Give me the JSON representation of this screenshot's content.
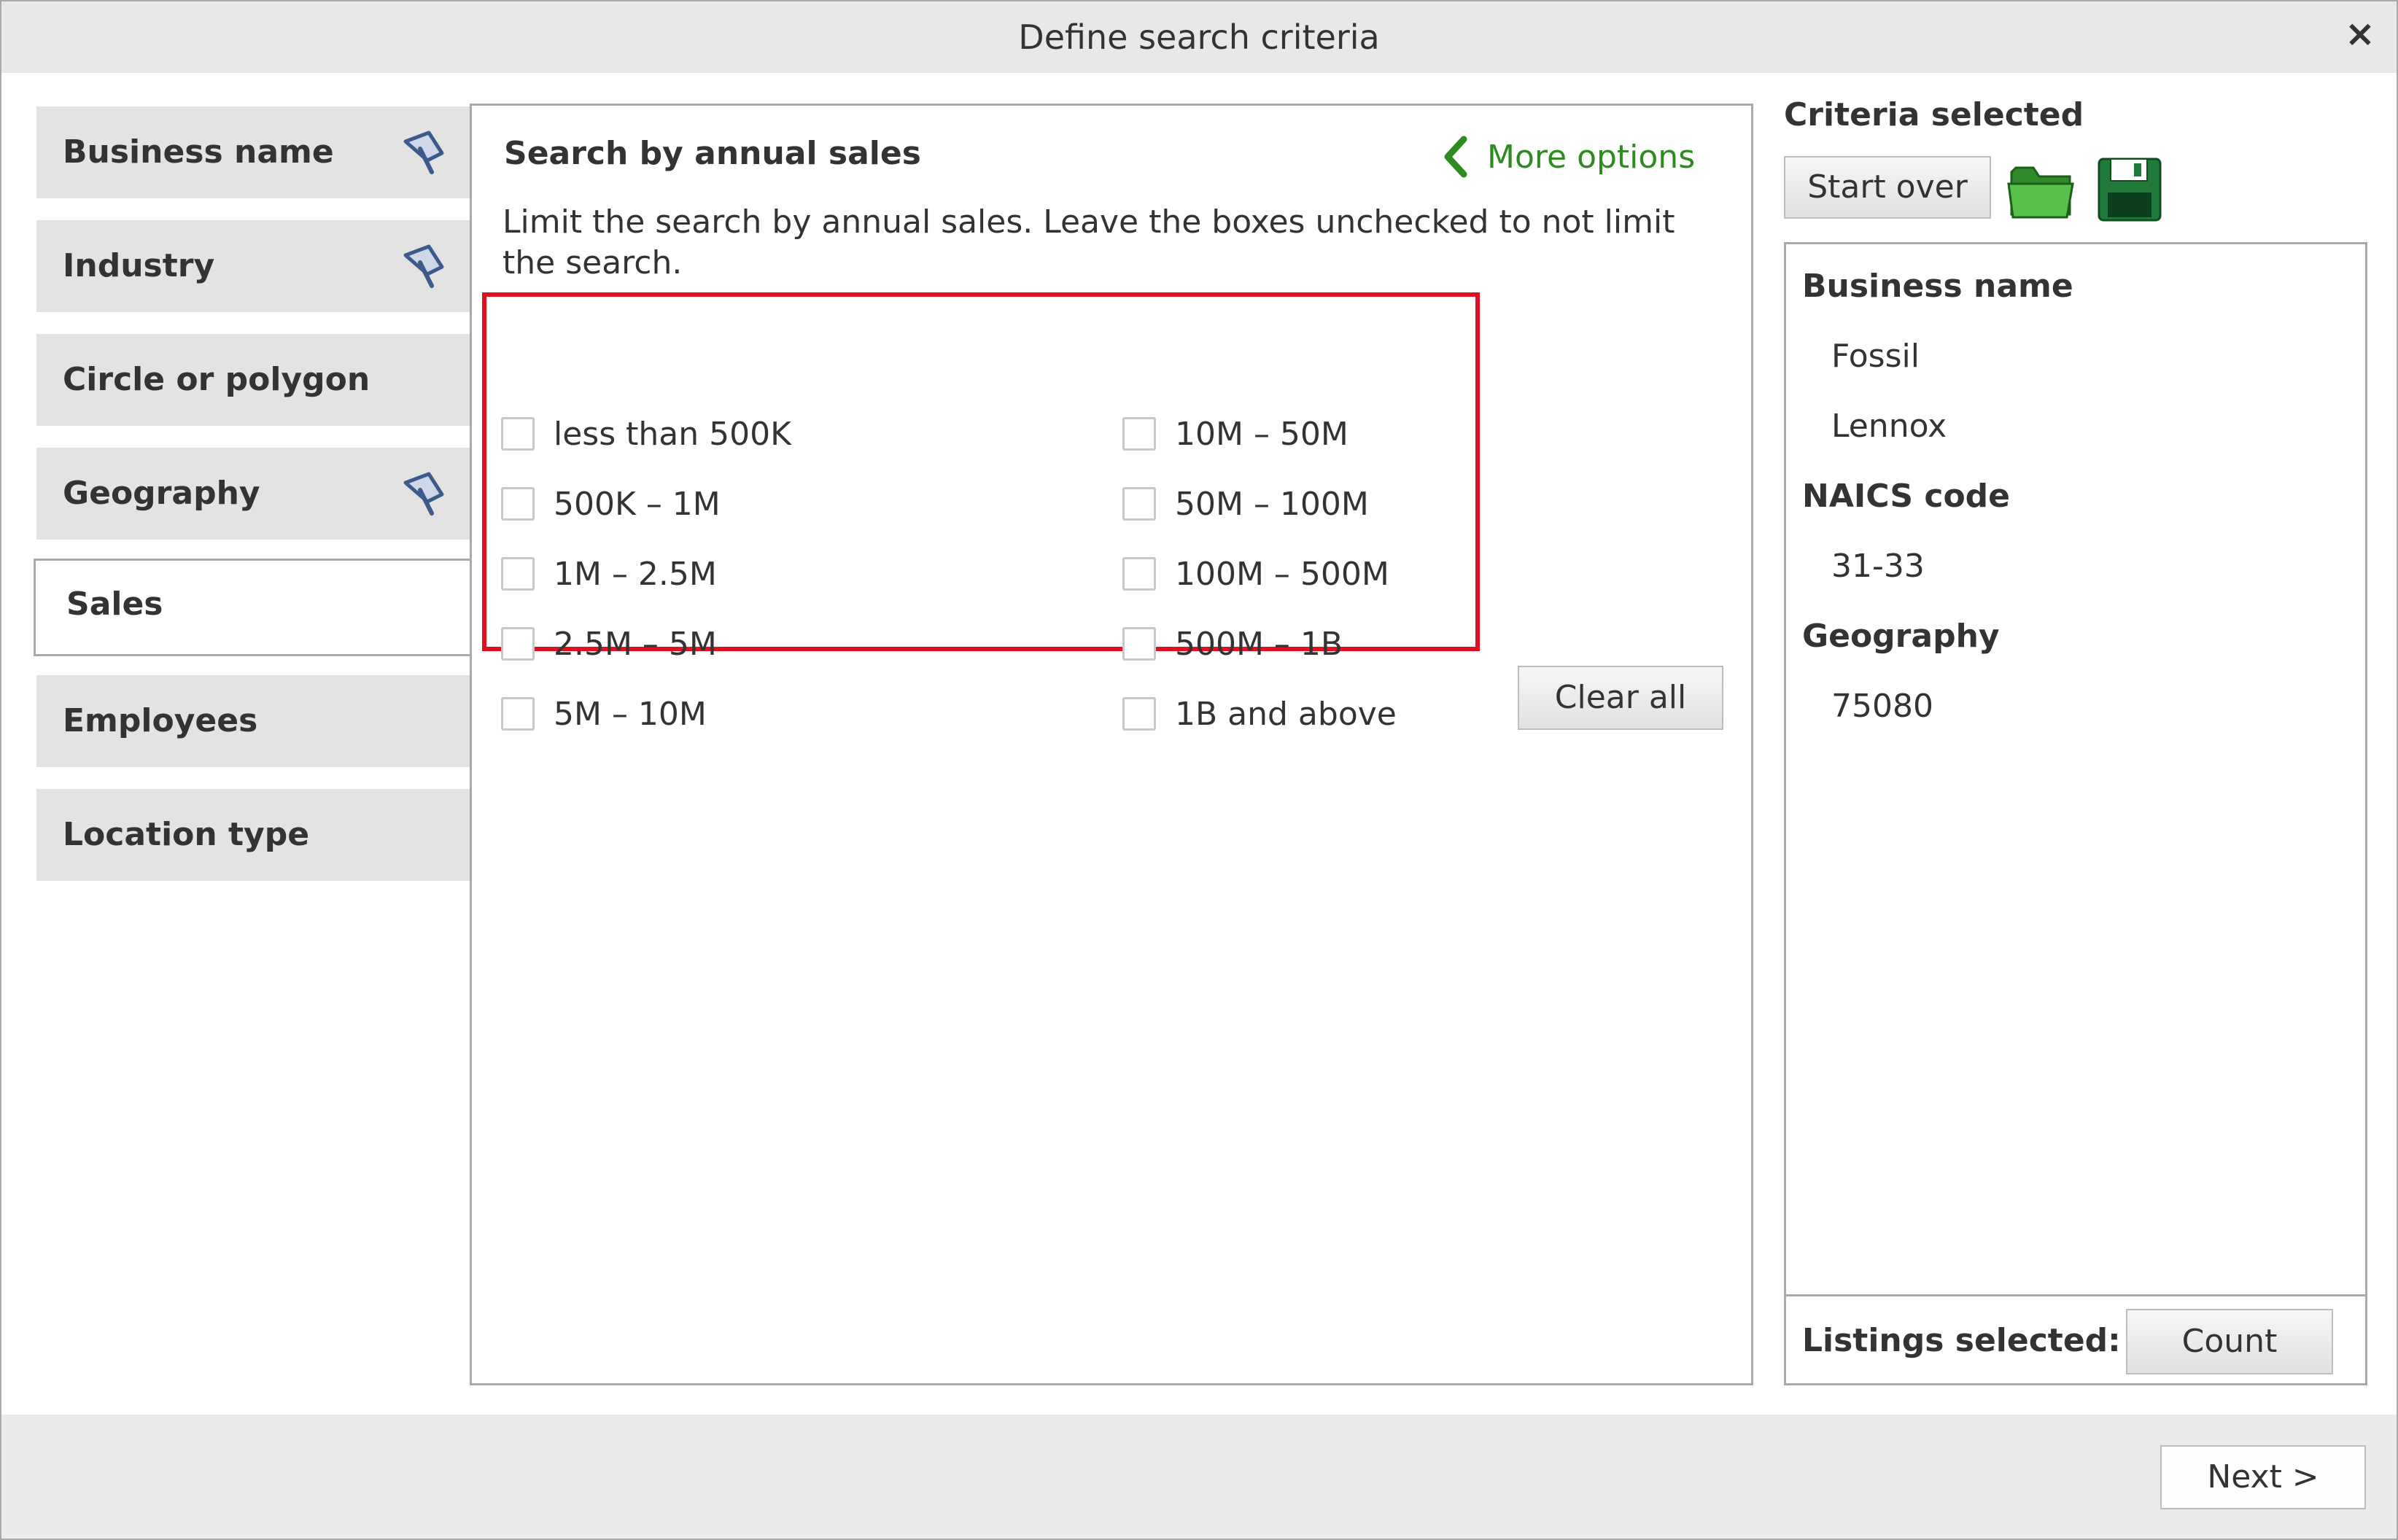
{
  "window": {
    "title": "Define search criteria",
    "close_glyph": "×"
  },
  "sidebar": {
    "items": [
      {
        "label": "Business name",
        "has_pin": true,
        "active": false
      },
      {
        "label": "Industry",
        "has_pin": true,
        "active": false
      },
      {
        "label": "Circle or polygon",
        "has_pin": false,
        "active": false
      },
      {
        "label": "Geography",
        "has_pin": true,
        "active": false
      },
      {
        "label": "Sales",
        "has_pin": false,
        "active": true
      },
      {
        "label": "Employees",
        "has_pin": false,
        "active": false
      },
      {
        "label": "Location type",
        "has_pin": false,
        "active": false
      }
    ]
  },
  "main": {
    "title": "Search by annual sales",
    "more_options": "More options",
    "description": "Limit the search by annual sales. Leave the boxes unchecked to not limit the search.",
    "options_left": [
      "less than 500K",
      "500K – 1M",
      "1M – 2.5M",
      "2.5M – 5M",
      "5M – 10M"
    ],
    "options_right": [
      "10M – 50M",
      "50M – 100M",
      "100M – 500M",
      "500M – 1B",
      "1B and above"
    ],
    "clear_all": "Clear all"
  },
  "criteria": {
    "title": "Criteria selected",
    "start_over": "Start over",
    "groups": [
      {
        "heading": "Business name",
        "values": [
          "Fossil",
          "Lennox"
        ]
      },
      {
        "heading": "NAICS code",
        "values": [
          "31-33"
        ]
      },
      {
        "heading": "Geography",
        "values": [
          "75080"
        ]
      }
    ],
    "listings_label": "Listings selected:",
    "count_button": "Count"
  },
  "footer": {
    "next_button": "Next >"
  },
  "colors": {
    "accent_green": "#2e8b22",
    "highlight_red": "#e0101e",
    "pin_blue": "#3c5a8c"
  },
  "icons": {
    "pin": "pushpin-icon",
    "more_options": "chevron-left-icon",
    "open": "folder-icon",
    "save": "floppy-disk-icon",
    "close": "close-icon"
  }
}
